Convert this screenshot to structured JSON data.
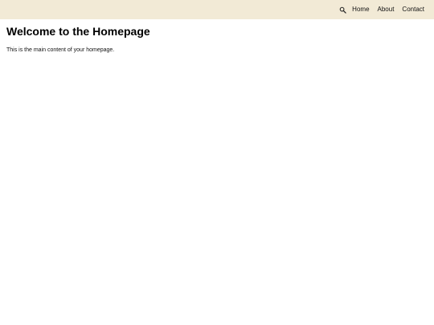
{
  "header": {
    "search_icon": "search-icon",
    "nav": [
      {
        "label": "Home"
      },
      {
        "label": "About"
      },
      {
        "label": "Contact"
      }
    ],
    "background_color": "#f2ead6"
  },
  "main": {
    "title": "Welcome to the Homepage",
    "text": "This is the main content of your homepage."
  }
}
